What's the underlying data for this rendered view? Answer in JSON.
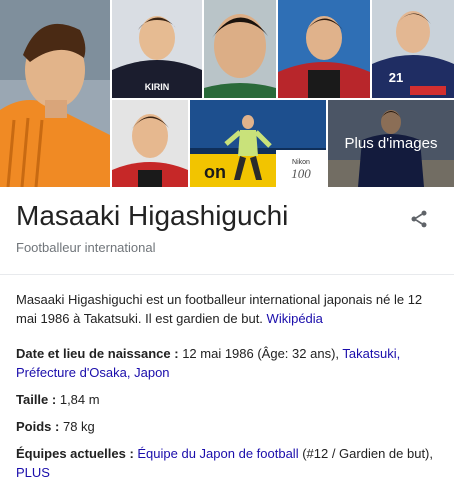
{
  "images": {
    "more_label": "Plus d'images",
    "tiles": [
      {
        "name": "photo-orange-goalkeeper",
        "jersey_color": "#f08a24"
      },
      {
        "name": "photo-dark-kirin-jersey",
        "jersey_color": "#1b1d2e",
        "jersey_text": "KIRIN"
      },
      {
        "name": "photo-portrait-green",
        "jersey_color": "#2a6a3a"
      },
      {
        "name": "photo-red-black-jersey",
        "jersey_color": "#b8262b"
      },
      {
        "name": "photo-blue-jersey-21",
        "jersey_color": "#1f2d63",
        "jersey_number": "21"
      },
      {
        "name": "photo-red-jersey-portrait",
        "jersey_color": "#c62828"
      },
      {
        "name": "photo-stadium-action",
        "banner_text": "Nikon 100th anniversary"
      },
      {
        "name": "photo-blue-team-jersey",
        "jersey_color": "#1f2d63"
      }
    ]
  },
  "entity": {
    "name": "Masaaki Higashiguchi",
    "subtitle": "Footballeur international",
    "share_icon": "share-icon"
  },
  "description": {
    "text": "Masaaki Higashiguchi est un footballeur international japonais né le 12 mai 1986 à Takatsuki. Il est gardien de but.",
    "source_link": "Wikipédia"
  },
  "facts": {
    "birth": {
      "label": "Date et lieu de naissance",
      "value": "12 mai 1986 (Âge: 32 ans),",
      "links": [
        "Takatsuki,",
        "Préfecture d'Osaka,",
        "Japon"
      ]
    },
    "height": {
      "label": "Taille",
      "value": "1,84 m"
    },
    "weight": {
      "label": "Poids",
      "value": "78 kg"
    },
    "teams": {
      "label": "Équipes actuelles",
      "link": "Équipe du Japon de football",
      "suffix": "(#12 / Gardien de but),",
      "more_link": "PLUS"
    }
  },
  "colors": {
    "link": "#1a0dab",
    "subtitle": "#70757a",
    "divider": "#e8eaed"
  }
}
